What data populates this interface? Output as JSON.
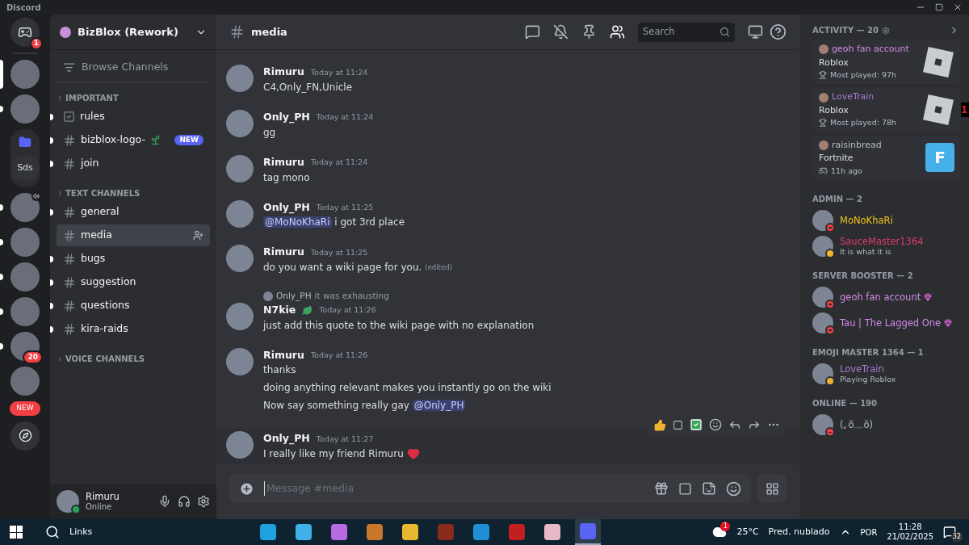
{
  "window": {
    "title": "Discord"
  },
  "servers": [
    {
      "kind": "home",
      "badge": "1",
      "unread": false,
      "selected": false
    },
    {
      "kind": "icon",
      "unread": false,
      "selected": true
    },
    {
      "kind": "icon",
      "unread": true,
      "selected": false
    },
    {
      "kind": "folder",
      "label": "Sds",
      "unread": false,
      "selected": false
    },
    {
      "kind": "icon",
      "unread": true,
      "selected": false,
      "speaker": true
    },
    {
      "kind": "icon",
      "unread": true,
      "selected": false
    },
    {
      "kind": "icon",
      "unread": true,
      "selected": false
    },
    {
      "kind": "icon",
      "unread": true,
      "selected": false
    },
    {
      "kind": "icon",
      "unread": true,
      "selected": false,
      "badge": "20"
    },
    {
      "kind": "icon",
      "unread": false,
      "selected": false
    },
    {
      "kind": "new",
      "label": "NEW",
      "unread": false,
      "selected": false
    },
    {
      "kind": "explore",
      "unread": false,
      "selected": false
    }
  ],
  "server_name": "BizBlox (Rework)",
  "browse": "Browse Channels",
  "categories": [
    {
      "name": "IMPORTANT",
      "channels": [
        {
          "kind": "rules",
          "name": "rules",
          "unread": true,
          "selected": false
        },
        {
          "kind": "text",
          "name": "bizblox-logo-",
          "unread": true,
          "selected": false,
          "emoji": true,
          "badge": "NEW"
        },
        {
          "kind": "text",
          "name": "join",
          "unread": true,
          "selected": false
        }
      ]
    },
    {
      "name": "TEXT CHANNELS",
      "channels": [
        {
          "kind": "text",
          "name": "general",
          "unread": true,
          "selected": false
        },
        {
          "kind": "text",
          "name": "media",
          "unread": false,
          "selected": true
        },
        {
          "kind": "text",
          "name": "bugs",
          "unread": true,
          "selected": false
        },
        {
          "kind": "text",
          "name": "suggestion",
          "unread": true,
          "selected": false
        },
        {
          "kind": "text",
          "name": "questions",
          "unread": true,
          "selected": false
        },
        {
          "kind": "text",
          "name": "kira-raids",
          "unread": true,
          "selected": false
        }
      ]
    },
    {
      "name": "VOICE CHANNELS"
    }
  ],
  "user": {
    "name": "Rimuru",
    "status": "Online",
    "online": true
  },
  "channel_header": {
    "name": "media",
    "search_placeholder": "Search"
  },
  "messages": [
    {
      "author": "Rimuru",
      "time": "Today at 11:24",
      "lines": [
        [
          {
            "kind": "text",
            "text": "C4,Only_FN,Unicle"
          }
        ]
      ]
    },
    {
      "author": "Only_PH",
      "time": "Today at 11:24",
      "lines": [
        [
          {
            "kind": "text",
            "text": "gg"
          }
        ]
      ]
    },
    {
      "author": "Rimuru",
      "time": "Today at 11:24",
      "lines": [
        [
          {
            "kind": "text",
            "text": "tag mono"
          }
        ]
      ]
    },
    {
      "author": "Only_PH",
      "time": "Today at 11:25",
      "lines": [
        [
          {
            "kind": "mention",
            "text": "@MoNoKhaRi"
          },
          {
            "kind": "text",
            "text": " i got 3rd place"
          }
        ]
      ]
    },
    {
      "author": "Rimuru",
      "time": "Today at 11:25",
      "edited": "(edited)",
      "lines": [
        [
          {
            "kind": "text",
            "text": "do you want a wiki page for you."
          }
        ]
      ]
    },
    {
      "author": "N7kie",
      "time": "Today at 11:26",
      "author_badge": true,
      "reply": {
        "author": "Only_PH",
        "text": "it was exhausting"
      },
      "lines": [
        [
          {
            "kind": "text",
            "text": "just add this quote to the wiki page with no explanation"
          }
        ]
      ]
    },
    {
      "author": "Rimuru",
      "time": "Today at 11:26",
      "lines": [
        [
          {
            "kind": "text",
            "text": "thanks"
          }
        ],
        [
          {
            "kind": "text",
            "text": "doing anything relevant makes you instantly go on the wiki"
          }
        ],
        [
          {
            "kind": "text",
            "text": "Now say something really gay "
          },
          {
            "kind": "mention",
            "text": "@Only_PH"
          }
        ]
      ]
    },
    {
      "author": "Only_PH",
      "time": "Today at 11:27",
      "hovered": true,
      "heart": true,
      "lines": [
        [
          {
            "kind": "text",
            "text": "I really like my friend Rimuru"
          }
        ]
      ]
    }
  ],
  "composer": {
    "placeholder": "Message #media"
  },
  "activity": {
    "title": "ACTIVITY — 20",
    "cards": [
      {
        "user": "geoh fan account",
        "color": "#d58be8",
        "game": "Roblox",
        "detail": "Most played: 97h",
        "kind": "trophy"
      },
      {
        "user": "LoveTrain",
        "color": "#a77bd0",
        "game": "Roblox",
        "detail": "Most played: 78h",
        "kind": "trophy",
        "counter": "1"
      },
      {
        "user": "raisinbread",
        "color": "#b5bac1",
        "game": "Fortnite",
        "detail": "11h ago",
        "kind": "gamepad",
        "art_letter": "F"
      }
    ]
  },
  "member_groups": [
    {
      "title": "ADMIN — 2",
      "members": [
        {
          "name": "MoNoKhaRi",
          "color": "#f0c419",
          "dnd": true
        },
        {
          "name": "SauceMaster1364",
          "color": "#e03b6a",
          "idle": true,
          "subtitle": "It is what it is"
        }
      ]
    },
    {
      "title": "SERVER BOOSTER — 2",
      "members": [
        {
          "name": "geoh fan account",
          "color": "#d58be8",
          "dnd": true,
          "booster": true
        },
        {
          "name": "Tau | The Lagged One",
          "color": "#d58be8",
          "dnd": true,
          "booster": true
        }
      ]
    },
    {
      "title": "EMOJI MASTER 1364 — 1",
      "members": [
        {
          "name": "LoveTrain",
          "color": "#a77bd0",
          "idle": true,
          "subtitle": "Playing Roblox"
        }
      ]
    },
    {
      "title": "ONLINE — 190",
      "members": [
        {
          "name": "(｡ŏ﹏ŏ)",
          "color": "#b5bac1",
          "dnd": true
        }
      ]
    }
  ],
  "taskbar": {
    "search": "Links",
    "weather": "25°C",
    "forecast": "Pred. nublado",
    "weather_badge": "1",
    "language": "POR",
    "time": "11:28",
    "date": "21/02/2025",
    "notifications": "32",
    "apps": [
      {
        "color": "#1fa3e0",
        "selected": false
      },
      {
        "color": "#3fb0e8",
        "selected": false
      },
      {
        "color": "#b86be0",
        "selected": false
      },
      {
        "color": "#c8762c",
        "selected": false
      },
      {
        "color": "#e8b830",
        "selected": false
      },
      {
        "color": "#8a2a1a",
        "selected": false
      },
      {
        "color": "#1f8fd6",
        "selected": false
      },
      {
        "color": "#c02020",
        "selected": false
      },
      {
        "color": "#e6b8c8",
        "selected": false
      },
      {
        "color": "#5865f2",
        "selected": true
      }
    ]
  }
}
